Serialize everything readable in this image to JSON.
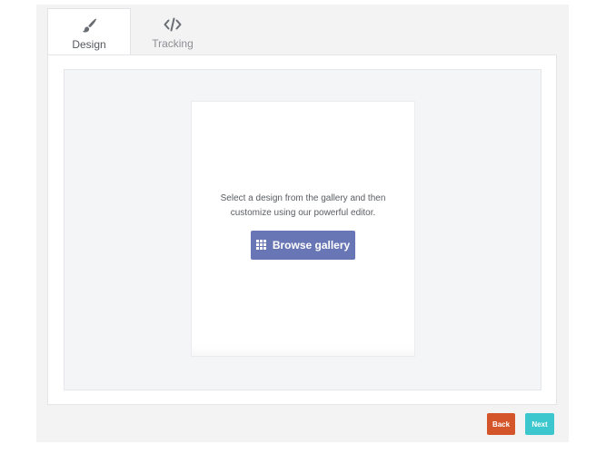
{
  "tabs": [
    {
      "label": "Design",
      "icon": "paintbrush-icon",
      "active": true
    },
    {
      "label": "Tracking",
      "icon": "code-icon",
      "active": false
    }
  ],
  "card": {
    "description": "Select a design from the gallery and then customize using our powerful editor.",
    "browse_label": "Browse gallery",
    "browse_icon": "grid-icon"
  },
  "footer": {
    "back_label": "Back",
    "next_label": "Next"
  },
  "colors": {
    "browse_button": "#6976b6",
    "back_button": "#d5552b",
    "next_button": "#3cc6cd"
  }
}
